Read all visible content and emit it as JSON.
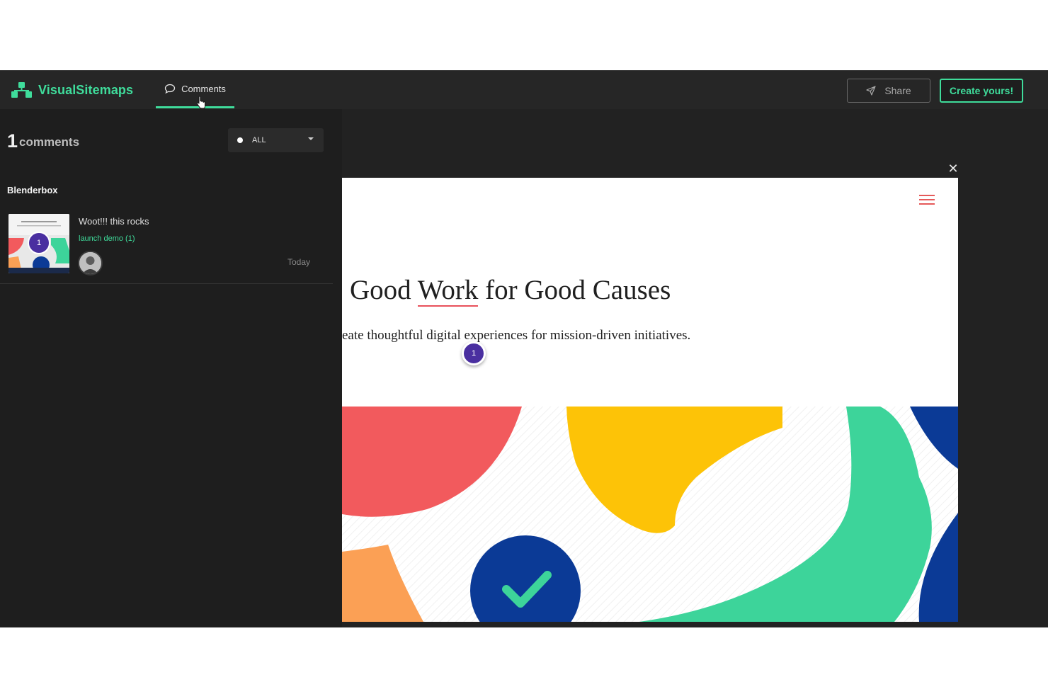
{
  "header": {
    "brand_name": "VisualSitemaps",
    "brand_color": "#3fdc9b",
    "tab_comments_label": "Comments",
    "share_label": "Share",
    "create_label": "Create yours!"
  },
  "panel": {
    "count": "1",
    "count_label": "comments",
    "filter": {
      "selected": "ALL"
    },
    "group_title": "Blenderbox",
    "comments": [
      {
        "pin_number": "1",
        "text": "Woot!!! this rocks",
        "link": "launch demo (1)",
        "time": "Today"
      }
    ]
  },
  "preview": {
    "headline_part1": "Good ",
    "headline_underlined": "Work",
    "headline_part2": " for Good Causes",
    "subline": "eate thoughtful digital experiences for mission-driven initiatives.",
    "pin_number": "1",
    "colors": {
      "red": "#f25a5d",
      "yellow": "#fdc307",
      "green": "#3dd49a",
      "navy": "#0b3a96",
      "orange": "#fba055",
      "pin": "#4a2fa0"
    }
  }
}
